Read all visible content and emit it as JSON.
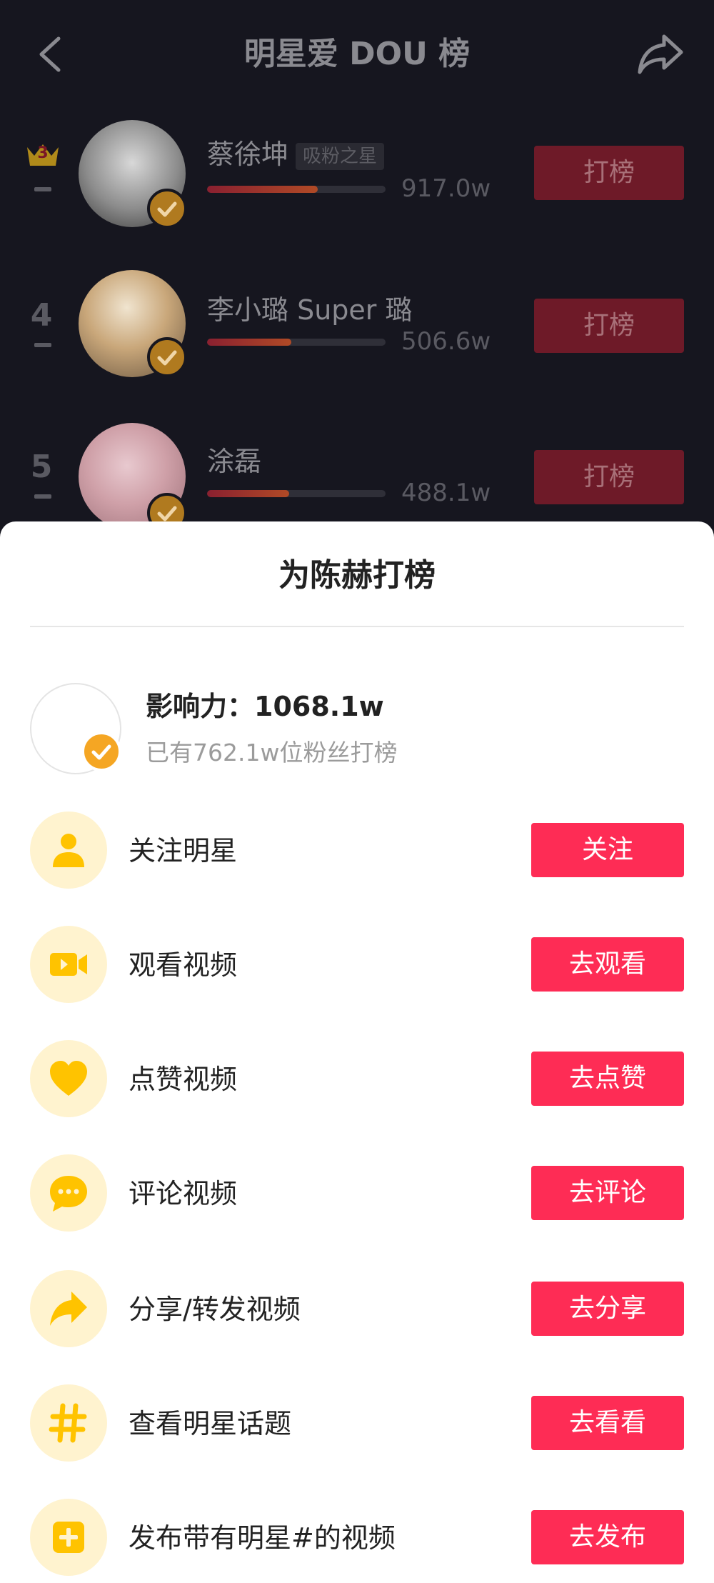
{
  "header": {
    "title": "明星爱 DOU 榜"
  },
  "ranking": [
    {
      "rank": "3",
      "crown": true,
      "name": "蔡徐坤",
      "tag": "吸粉之星",
      "score": "917.0w",
      "progress": 0.62,
      "button": "打榜"
    },
    {
      "rank": "4",
      "crown": false,
      "name": "李小璐 Super 璐",
      "tag": "",
      "score": "506.6w",
      "progress": 0.47,
      "button": "打榜"
    },
    {
      "rank": "5",
      "crown": false,
      "name": "涂磊",
      "tag": "",
      "score": "488.1w",
      "progress": 0.46,
      "button": "打榜"
    }
  ],
  "sheet": {
    "title": "为陈赫打榜",
    "influence_label": "影响力：",
    "influence_value": "1068.1w",
    "fans_text": "已有762.1w位粉丝打榜"
  },
  "tasks": [
    {
      "icon": "person-icon",
      "label": "关注明星",
      "button": "关注"
    },
    {
      "icon": "video-camera-icon",
      "label": "观看视频",
      "button": "去观看"
    },
    {
      "icon": "heart-icon",
      "label": "点赞视频",
      "button": "去点赞"
    },
    {
      "icon": "comment-icon",
      "label": "评论视频",
      "button": "去评论"
    },
    {
      "icon": "share-arrow-icon",
      "label": "分享/转发视频",
      "button": "去分享"
    },
    {
      "icon": "hashtag-icon",
      "label": "查看明星话题",
      "button": "去看看"
    },
    {
      "icon": "plus-box-icon",
      "label": "发布带有明星#的视频",
      "button": "去发布"
    }
  ],
  "colors": {
    "accent": "#fe2c55",
    "icon_yellow": "#ffc300",
    "icon_bg": "#fff3cf",
    "verify_badge": "#f5a623"
  }
}
